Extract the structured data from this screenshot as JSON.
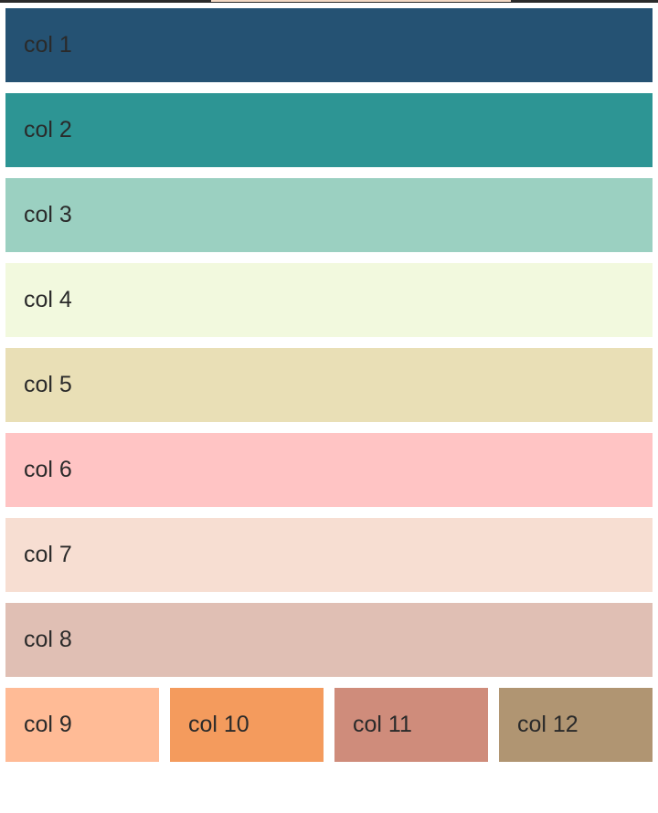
{
  "grid": {
    "full_rows": [
      {
        "label": "col 1",
        "color": "#255273"
      },
      {
        "label": "col 2",
        "color": "#2d9594"
      },
      {
        "label": "col 3",
        "color": "#9bd0c1"
      },
      {
        "label": "col 4",
        "color": "#f2f9de"
      },
      {
        "label": "col 5",
        "color": "#e9dfb6"
      },
      {
        "label": "col 6",
        "color": "#ffc4c4"
      },
      {
        "label": "col 7",
        "color": "#f7ded2"
      },
      {
        "label": "col 8",
        "color": "#e0bfb4"
      }
    ],
    "quarter_row": [
      {
        "label": "col 9",
        "color": "#ffbb96"
      },
      {
        "label": "col 10",
        "color": "#f49b5d"
      },
      {
        "label": "col 11",
        "color": "#cf8c7b"
      },
      {
        "label": "col 12",
        "color": "#b09572"
      }
    ]
  }
}
